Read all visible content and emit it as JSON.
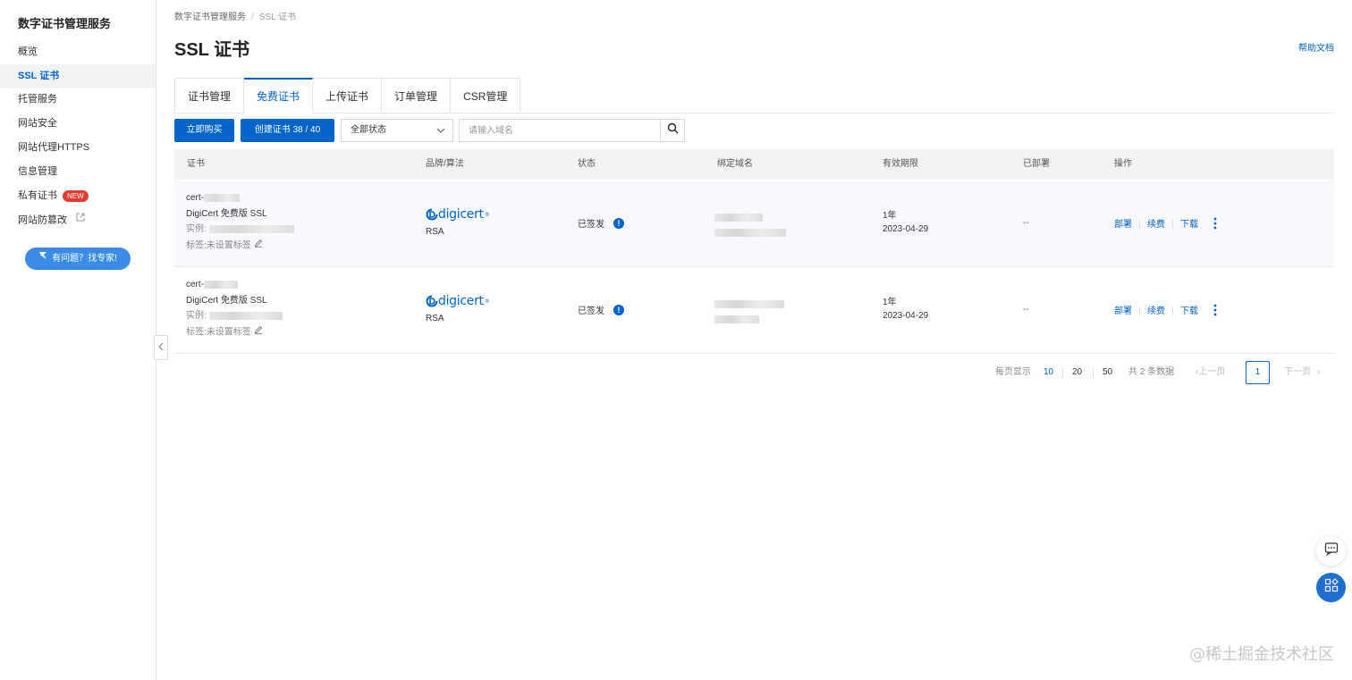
{
  "sidebar": {
    "title": "数字证书管理服务",
    "items": [
      {
        "label": "概览"
      },
      {
        "label": "SSL 证书"
      },
      {
        "label": "托管服务"
      },
      {
        "label": "网站安全"
      },
      {
        "label": "网站代理HTTPS"
      },
      {
        "label": "信息管理"
      },
      {
        "label": "私有证书",
        "badge": "NEW"
      },
      {
        "label": "网站防篡改"
      }
    ],
    "expert_button": "有问题？找专家!"
  },
  "breadcrumb": {
    "root": "数字证书管理服务",
    "separator": "/",
    "current": "SSL 证书"
  },
  "page": {
    "title": "SSL 证书",
    "help_link": "帮助文档"
  },
  "tabs": [
    {
      "label": "证书管理"
    },
    {
      "label": "免费证书"
    },
    {
      "label": "上传证书"
    },
    {
      "label": "订单管理"
    },
    {
      "label": "CSR管理"
    }
  ],
  "toolbar": {
    "buy_label": "立即购买",
    "create_label": "创建证书 38 / 40",
    "status_select": "全部状态",
    "search_placeholder": "请输入域名"
  },
  "table": {
    "columns": [
      "证书",
      "品牌/算法",
      "状态",
      "绑定域名",
      "有效期限",
      "已部署",
      "操作"
    ],
    "rows": [
      {
        "cert_id": "cert-",
        "cert_type": "DigiCert 免费版 SSL",
        "instance_label": "实例:",
        "tag_label": "标签:未设置标签",
        "brand": "digicert",
        "algorithm": "RSA",
        "status": "已签发",
        "validity_period": "1年",
        "validity_date": "2023-04-29",
        "deployed": "--",
        "actions": [
          "部署",
          "续费",
          "下载"
        ]
      },
      {
        "cert_id": "cert-",
        "cert_type": "DigiCert 免费版 SSL",
        "instance_label": "实例:",
        "tag_label": "标签:未设置标签",
        "brand": "digicert",
        "algorithm": "RSA",
        "status": "已签发",
        "validity_period": "1年",
        "validity_date": "2023-04-29",
        "deployed": "--",
        "actions": [
          "部署",
          "续费",
          "下载"
        ]
      }
    ]
  },
  "pagination": {
    "per_page_label": "每页显示",
    "sizes": [
      "10",
      "20",
      "50"
    ],
    "total_label": "共 2 条数据",
    "prev_label": "上一页",
    "current_page": "1",
    "next_label": "下一页"
  },
  "colors": {
    "accent": "#0064c8",
    "badge": "#e33b2e",
    "expert": "#3b8ce8"
  },
  "watermark": "@稀土掘金技术社区"
}
